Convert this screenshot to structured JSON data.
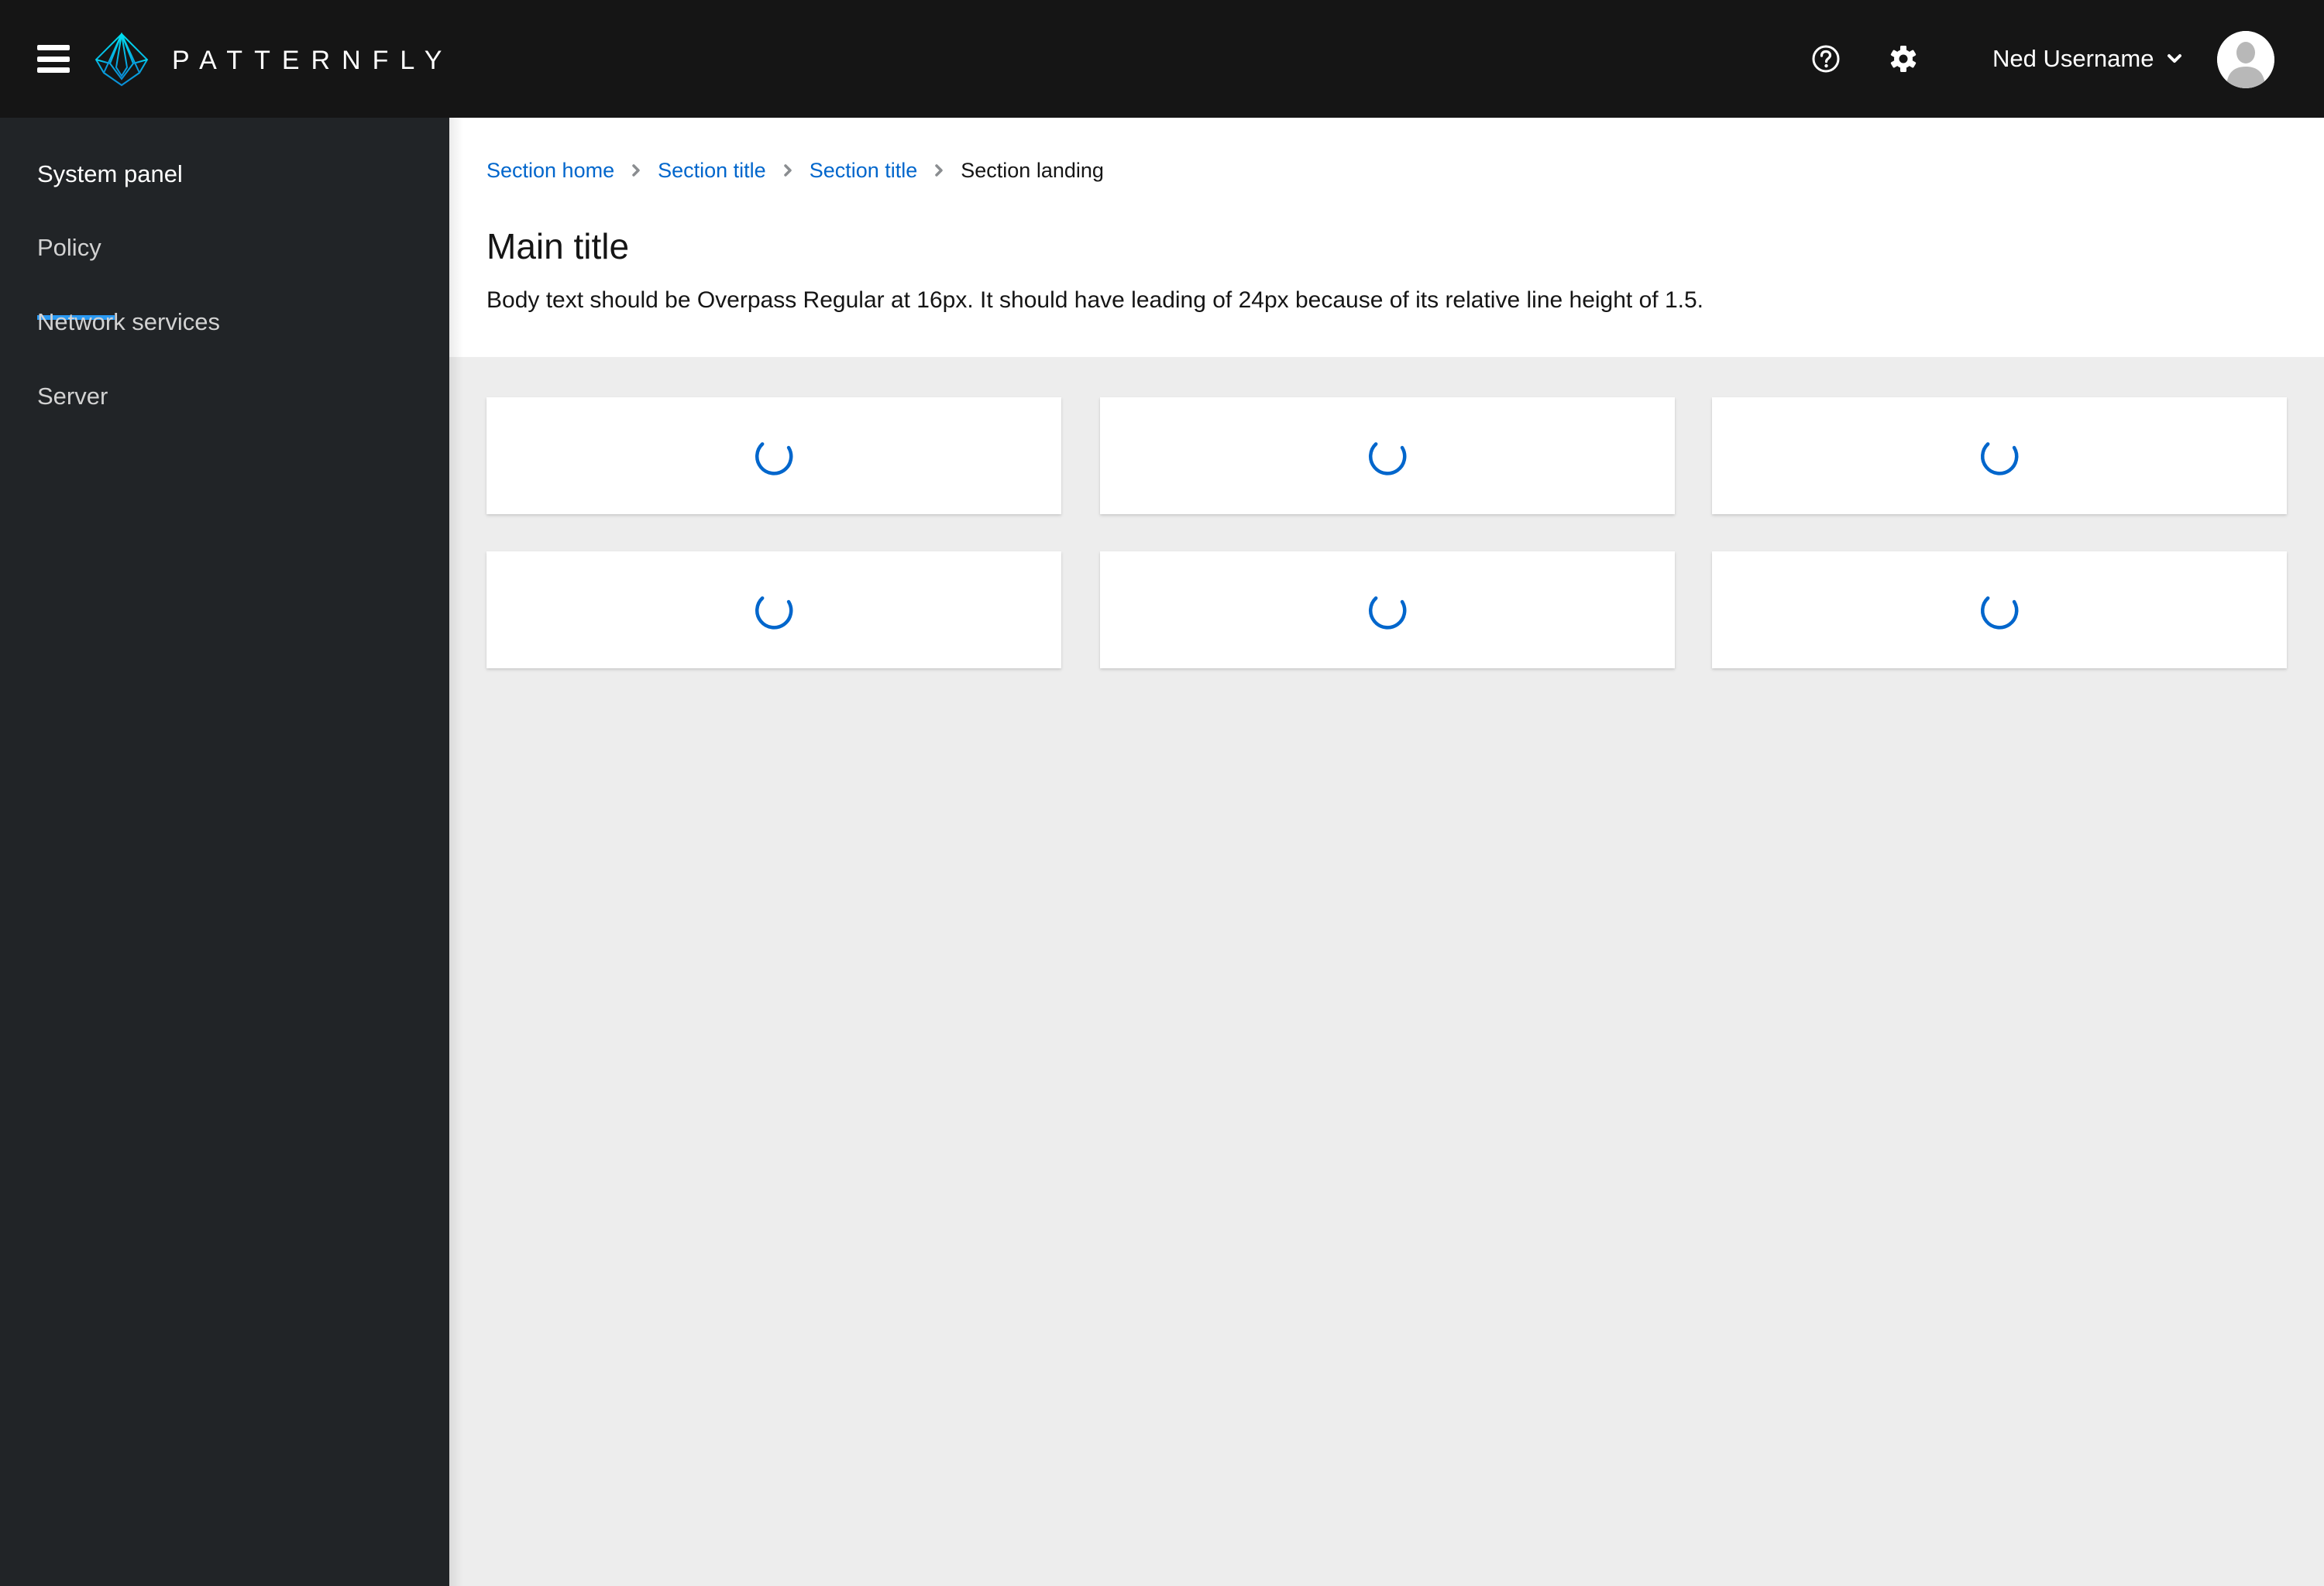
{
  "masthead": {
    "brand": "PATTERNFLY",
    "username": "Ned Username",
    "icons": {
      "menu": "hamburger-icon",
      "logo": "patternfly-logo-icon",
      "help": "question-circle-icon",
      "settings": "gear-icon",
      "user_caret": "chevron-down-icon",
      "avatar": "avatar-icon"
    }
  },
  "sidebar": {
    "items": [
      {
        "label": "System panel",
        "active": true
      },
      {
        "label": "Policy",
        "active": false
      },
      {
        "label": "Network services",
        "active": false
      },
      {
        "label": "Server",
        "active": false
      }
    ]
  },
  "breadcrumb": {
    "items": [
      {
        "label": "Section home",
        "link": true
      },
      {
        "label": "Section title",
        "link": true
      },
      {
        "label": "Section title",
        "link": true
      },
      {
        "label": "Section landing",
        "link": false
      }
    ]
  },
  "page": {
    "title": "Main title",
    "body": "Body text should be Overpass Regular at 16px. It should have leading of 24px because of its relative line height of 1.5."
  },
  "cards": {
    "count": 6,
    "state": "loading"
  },
  "colors": {
    "masthead_bg": "#151515",
    "sidebar_bg": "#212427",
    "accent": "#2b9af3",
    "link": "#0066cc",
    "spinner": "#0066cc",
    "content_bg": "#ededed"
  }
}
